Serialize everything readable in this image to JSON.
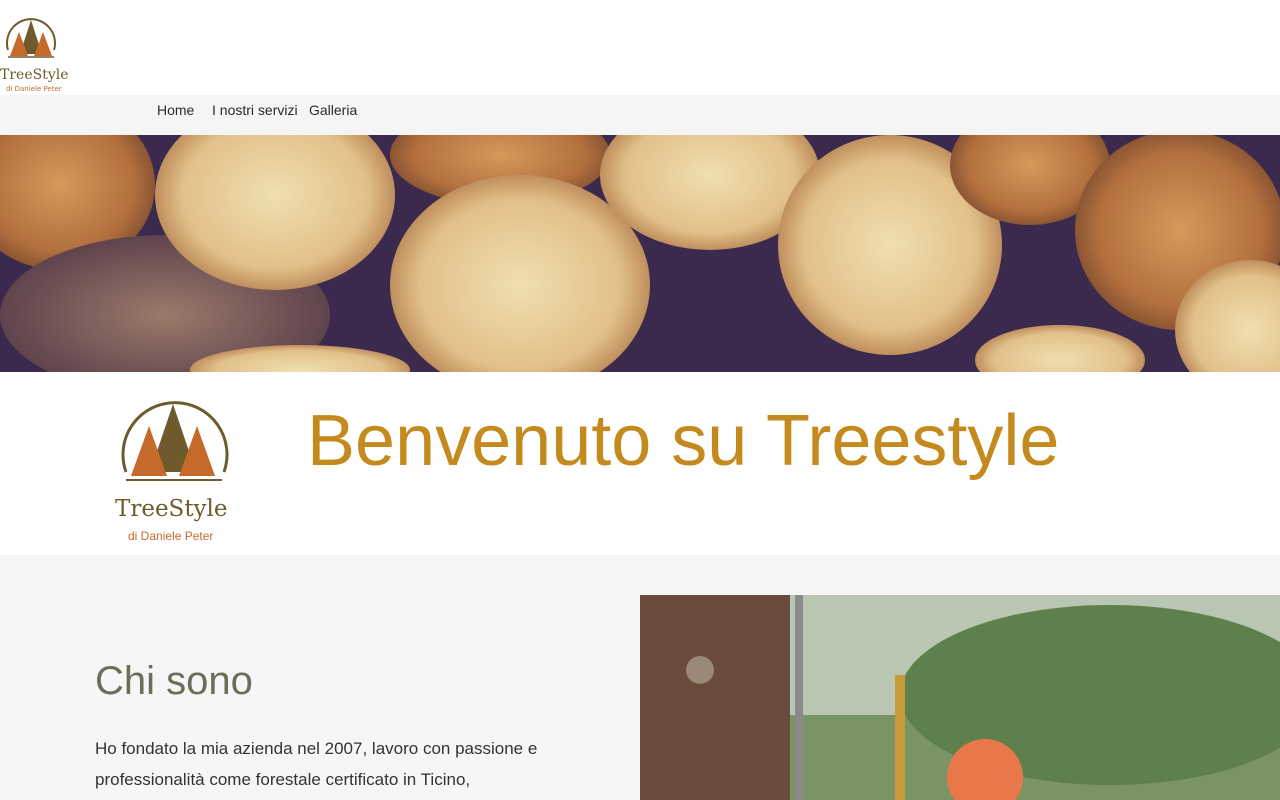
{
  "logo": {
    "brand": "TreeStyle",
    "subtitle": "di Daniele Peter"
  },
  "nav": {
    "items": [
      {
        "label": "Home"
      },
      {
        "label": "I nostri servizi"
      },
      {
        "label": "Galleria"
      }
    ]
  },
  "welcome": {
    "title": "Benvenuto su Treestyle"
  },
  "about": {
    "title": "Chi sono",
    "text_line1": "Ho fondato la mia azienda nel 2007, lavoro con passione e",
    "text_line2": "professionalità come forestale certificato in Ticino,"
  },
  "colors": {
    "accent": "#c58a1e",
    "logo_brown": "#6e5a2c",
    "logo_orange": "#c56a2a",
    "nav_bg": "#f5f5f5"
  },
  "icons": {
    "logo": "tree-logo-icon"
  }
}
